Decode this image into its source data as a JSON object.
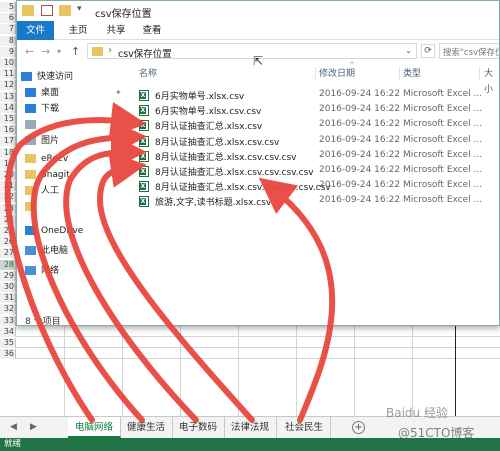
{
  "explorer": {
    "title": "csv保存位置",
    "ribbon": [
      "文件",
      "主页",
      "共享",
      "查看"
    ],
    "address": "csv保存位置",
    "search_placeholder": "搜索\"csv保存位置\"",
    "columns": [
      "名称",
      "修改日期",
      "类型",
      "大小"
    ],
    "nav_items": [
      {
        "label": "快速访问",
        "icon": "star-icon",
        "color": "#2f7fd6",
        "pinned": false
      },
      {
        "label": "桌面",
        "icon": "desktop-icon",
        "color": "#2a7fd4",
        "pinned": true
      },
      {
        "label": "下载",
        "icon": "download-icon",
        "color": "#2a7fd4",
        "pinned": true
      },
      {
        "label": "",
        "icon": "documents-icon",
        "color": "#9aa8b8",
        "pinned": true
      },
      {
        "label": "图片",
        "icon": "pictures-icon",
        "color": "#9aa8b8",
        "pinned": true
      },
      {
        "label": "eRecv",
        "icon": "folder-icon",
        "color": "#e8c560",
        "pinned": false
      },
      {
        "label": "Snagit",
        "icon": "folder-icon",
        "color": "#e8c560",
        "pinned": false
      },
      {
        "label": "人工",
        "icon": "folder-icon",
        "color": "#e8c560",
        "pinned": false
      },
      {
        "label": "",
        "icon": "folder-icon",
        "color": "#e8c560",
        "pinned": false
      },
      {
        "label": "OneDrive",
        "icon": "cloud-icon",
        "color": "#2a7fd4",
        "pinned": false
      },
      {
        "label": "此电脑",
        "icon": "computer-icon",
        "color": "#4a90d9",
        "pinned": false
      },
      {
        "label": "网络",
        "icon": "network-icon",
        "color": "#4a90d9",
        "pinned": false
      }
    ],
    "files": [
      {
        "name": "6月实物单号.xlsx.csv",
        "date": "2016-09-24 16:22",
        "type": "Microsoft Excel ..."
      },
      {
        "name": "6月实物单号.xlsx.csv.csv",
        "date": "2016-09-24 16:22",
        "type": "Microsoft Excel ..."
      },
      {
        "name": "8月认证抽查汇总.xlsx.csv",
        "date": "2016-09-24 16:22",
        "type": "Microsoft Excel ..."
      },
      {
        "name": "8月认证抽查汇总.xlsx.csv.csv",
        "date": "2016-09-24 16:22",
        "type": "Microsoft Excel ..."
      },
      {
        "name": "8月认证抽查汇总.xlsx.csv.csv.csv",
        "date": "2016-09-24 16:22",
        "type": "Microsoft Excel ..."
      },
      {
        "name": "8月认证抽查汇总.xlsx.csv.csv.csv.csv",
        "date": "2016-09-24 16:22",
        "type": "Microsoft Excel ..."
      },
      {
        "name": "8月认证抽查汇总.xlsx.csv.csv.csv.csv.csv",
        "date": "2016-09-24 16:22",
        "type": "Microsoft Excel ..."
      },
      {
        "name": "旅游,文字,读书标题.xlsx.csv",
        "date": "2016-09-24 16:22",
        "type": "Microsoft Excel ..."
      }
    ],
    "item_count": "8 个项目"
  },
  "row_numbers": [
    "5",
    "6",
    "7",
    "8",
    "9",
    "10",
    "11",
    "12",
    "13",
    "14",
    "15",
    "16",
    "17",
    "18",
    "19",
    "20",
    "21",
    "22",
    "23",
    "24",
    "25",
    "26",
    "27",
    "28",
    "29",
    "30",
    "31",
    "32",
    "33",
    "34",
    "35",
    "36"
  ],
  "active_row": "28",
  "sheets": [
    "电脑网络",
    "健康生活",
    "电子数码",
    "法律法规",
    "社会民生"
  ],
  "sheet_add_label": "+",
  "excel_status": "就绪",
  "watermark": {
    "primary": "Baidu 经验",
    "secondary": "@51CTO博客"
  },
  "colors": {
    "accent": "#1979ca",
    "excel_green": "#217346",
    "arrow": "#e8483f",
    "folder": "#e8c560"
  }
}
